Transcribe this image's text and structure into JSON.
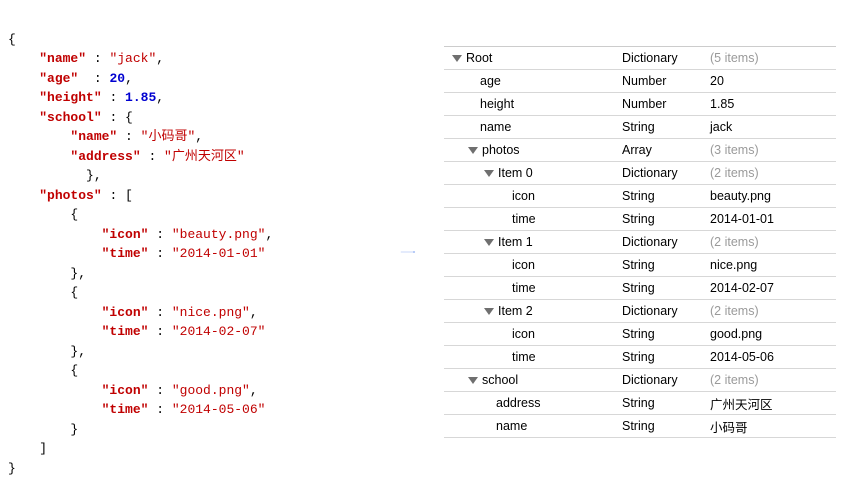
{
  "json_source": {
    "openBrace": "{",
    "closeBrace": "}",
    "entries": {
      "name": {
        "key": "\"name\"",
        "colon": " : ",
        "val": "\"jack\"",
        "comma": ","
      },
      "age": {
        "key": "\"age\"",
        "colon": "  : ",
        "val": "20",
        "comma": ","
      },
      "height": {
        "key": "\"height\"",
        "colon": " : ",
        "val": "1.85",
        "comma": ","
      },
      "school": {
        "key": "\"school\"",
        "colon": " : ",
        "open": "{",
        "close": "}",
        "comma": ",",
        "name": {
          "key": "\"name\"",
          "colon": " : ",
          "val": "\"小码哥\"",
          "comma": ","
        },
        "address": {
          "key": "\"address\"",
          "colon": " : ",
          "val": "\"广州天河区\""
        }
      },
      "photos": {
        "key": "\"photos\"",
        "colon": " : ",
        "open": "[",
        "close": "]",
        "items": [
          {
            "open": "{",
            "close": "}",
            "comma": ",",
            "icon": {
              "key": "\"icon\"",
              "colon": " : ",
              "val": "\"beauty.png\"",
              "comma": ","
            },
            "time": {
              "key": "\"time\"",
              "colon": " : ",
              "val": "\"2014-01-01\""
            }
          },
          {
            "open": "{",
            "close": "}",
            "comma": ",",
            "icon": {
              "key": "\"icon\"",
              "colon": " : ",
              "val": "\"nice.png\"",
              "comma": ","
            },
            "time": {
              "key": "\"time\"",
              "colon": " : ",
              "val": "\"2014-02-07\""
            }
          },
          {
            "open": "{",
            "close": "}",
            "icon": {
              "key": "\"icon\"",
              "colon": " : ",
              "val": "\"good.png\"",
              "comma": ","
            },
            "time": {
              "key": "\"time\"",
              "colon": " : ",
              "val": "\"2014-05-06\""
            }
          }
        ]
      }
    }
  },
  "table": [
    {
      "indent": 0,
      "disclosure": true,
      "key": "Root",
      "type": "Dictionary",
      "value": "(5 items)",
      "dim": true
    },
    {
      "indent": 1,
      "disclosure": false,
      "key": "age",
      "type": "Number",
      "value": "20",
      "dim": false
    },
    {
      "indent": 1,
      "disclosure": false,
      "key": "height",
      "type": "Number",
      "value": "1.85",
      "dim": false
    },
    {
      "indent": 1,
      "disclosure": false,
      "key": "name",
      "type": "String",
      "value": "jack",
      "dim": false
    },
    {
      "indent": 1,
      "disclosure": true,
      "key": "photos",
      "type": "Array",
      "value": "(3 items)",
      "dim": true
    },
    {
      "indent": 2,
      "disclosure": true,
      "key": "Item 0",
      "type": "Dictionary",
      "value": "(2 items)",
      "dim": true
    },
    {
      "indent": 3,
      "disclosure": false,
      "key": "icon",
      "type": "String",
      "value": "beauty.png",
      "dim": false
    },
    {
      "indent": 3,
      "disclosure": false,
      "key": "time",
      "type": "String",
      "value": "2014-01-01",
      "dim": false
    },
    {
      "indent": 2,
      "disclosure": true,
      "key": "Item 1",
      "type": "Dictionary",
      "value": "(2 items)",
      "dim": true
    },
    {
      "indent": 3,
      "disclosure": false,
      "key": "icon",
      "type": "String",
      "value": "nice.png",
      "dim": false
    },
    {
      "indent": 3,
      "disclosure": false,
      "key": "time",
      "type": "String",
      "value": "2014-02-07",
      "dim": false
    },
    {
      "indent": 2,
      "disclosure": true,
      "key": "Item 2",
      "type": "Dictionary",
      "value": "(2 items)",
      "dim": true
    },
    {
      "indent": 3,
      "disclosure": false,
      "key": "icon",
      "type": "String",
      "value": "good.png",
      "dim": false
    },
    {
      "indent": 3,
      "disclosure": false,
      "key": "time",
      "type": "String",
      "value": "2014-05-06",
      "dim": false
    },
    {
      "indent": 1,
      "disclosure": true,
      "key": "school",
      "type": "Dictionary",
      "value": "(2 items)",
      "dim": true
    },
    {
      "indent": 2,
      "disclosure": false,
      "key": "address",
      "type": "String",
      "value": "广州天河区",
      "dim": false
    },
    {
      "indent": 2,
      "disclosure": false,
      "key": "name",
      "type": "String",
      "value": "小码哥",
      "dim": false
    }
  ]
}
